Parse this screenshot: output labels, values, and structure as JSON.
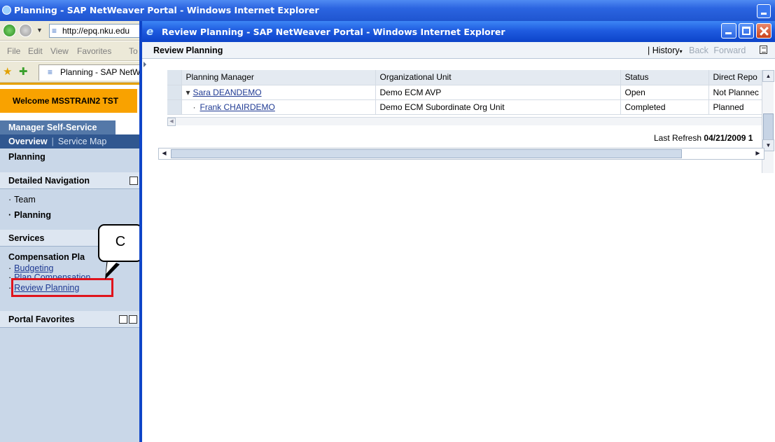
{
  "background_window": {
    "title": "Planning - SAP NetWeaver Portal - Windows Internet Explorer",
    "address": "http://epq.nku.edu",
    "menu": [
      "File",
      "Edit",
      "View",
      "Favorites",
      "To"
    ],
    "tab_label": "Planning - SAP NetWe",
    "welcome": "Welcome MSSTRAIN2 TST",
    "top_tab": "Manager Self-Service",
    "top_nav": {
      "overview": "Overview",
      "separator": "|",
      "service_map": "Service Map"
    },
    "left_nav": {
      "planning_header": "Planning",
      "detailed_nav_header": "Detailed Navigation",
      "detailed_items": [
        "Team",
        "Planning"
      ],
      "services_header": "Services",
      "compensation_header": "Compensation Pla",
      "service_links": [
        "Budgeting",
        "Plan Compensation",
        "Review Planning"
      ],
      "portal_favorites": "Portal Favorites"
    },
    "callout_label": "C"
  },
  "popup": {
    "title": "Review Planning - SAP NetWeaver Portal - Windows Internet Explorer",
    "header_title": "Review Planning",
    "header_nav": {
      "sep": "|",
      "history": "History",
      "back": "Back",
      "forward": "Forward"
    },
    "table": {
      "columns": [
        "Planning Manager",
        "Organizational Unit",
        "Status",
        "Direct Repo"
      ],
      "rows": [
        {
          "bullet": "▾",
          "manager": "Sara DEANDEMO",
          "org_unit": "Demo ECM AVP",
          "status": "Open",
          "direct": "Not Plannec"
        },
        {
          "bullet": "·",
          "manager": "Frank CHAIRDEMO",
          "org_unit": "Demo ECM Subordinate Org Unit",
          "status": "Completed",
          "direct": "Planned"
        }
      ]
    },
    "last_refresh_label": "Last Refresh",
    "last_refresh_value": "04/21/2009 1"
  },
  "colors": {
    "xp_titlebar": "#1f5ce0",
    "welcome_orange": "#f9a200",
    "nav_blue": "#305790",
    "highlight_red": "#e0141c"
  }
}
